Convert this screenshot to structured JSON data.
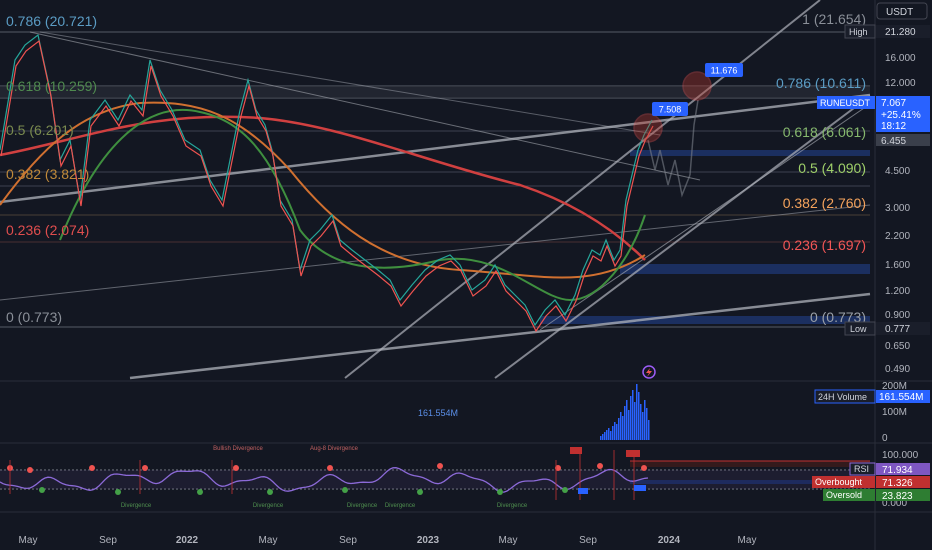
{
  "header": {
    "currency_button": "USDT"
  },
  "price_axis": {
    "ticks": [
      "16.000",
      "12.000",
      "6.455",
      "4.500",
      "3.000",
      "2.200",
      "1.600",
      "1.200",
      "0.900",
      "0.650",
      "0.490"
    ],
    "high": {
      "label": "High",
      "value": "21.280"
    },
    "low": {
      "label": "Low",
      "value": "0.777"
    },
    "current": {
      "symbol": "RUNEUSDT",
      "price": "7.067",
      "change": "+25.41%",
      "countdown": "18:12"
    }
  },
  "fib_left": [
    {
      "text": "0.786 (20.721)",
      "color": "#5b9cc4"
    },
    {
      "text": "0.618 (10.259)",
      "color": "#4f8a4f"
    },
    {
      "text": "0.5 (6.201)",
      "color": "#7a8a4f"
    },
    {
      "text": "0.382 (3.821)",
      "color": "#c08a3a"
    },
    {
      "text": "0.236 (2.074)",
      "color": "#e04e4e"
    },
    {
      "text": "0 (0.773)",
      "color": "#8a8f98"
    }
  ],
  "fib_right": [
    {
      "text": "1 (21.654)",
      "color": "#8a8f98"
    },
    {
      "text": "0.786 (10.611)",
      "color": "#5b9cc4"
    },
    {
      "text": "0.618 (6.061)",
      "color": "#86b86e"
    },
    {
      "text": "0.5 (4.090)",
      "color": "#9fd06a"
    },
    {
      "text": "0.382 (2.760)",
      "color": "#f5a35c"
    },
    {
      "text": "0.236 (1.697)",
      "color": "#f25656"
    },
    {
      "text": "0 (0.773)",
      "color": "#9aa0a8"
    }
  ],
  "callouts": [
    {
      "text": "7.508"
    },
    {
      "text": "11.676"
    }
  ],
  "volume": {
    "label": "24H Volume",
    "value": "161.554M",
    "inline_label": "161.554M",
    "ticks": [
      "200M",
      "100M",
      "0"
    ]
  },
  "rsi": {
    "ticks": [
      "100.000",
      "0.000"
    ],
    "rsi": {
      "label": "RSI",
      "value": "71.934"
    },
    "overbought": {
      "label": "Overbought",
      "value": "71.326"
    },
    "oversold": {
      "label": "Oversold",
      "value": "23.823"
    },
    "annotations": [
      "Bullish Divergence",
      "Aug-8 Divergence",
      "Divergence",
      "Divergence",
      "Divergence",
      "Divergence",
      "Divergence"
    ]
  },
  "time_axis": [
    "May",
    "Sep",
    "2022",
    "May",
    "Sep",
    "2023",
    "May",
    "Sep",
    "2024",
    "May"
  ],
  "chart_data": {
    "type": "line",
    "title": "RUNEUSDT",
    "series": [
      {
        "name": "RUNEUSDT",
        "x": [
          "2021-05",
          "2021-07",
          "2021-09",
          "2021-11",
          "2022-01",
          "2022-03",
          "2022-04",
          "2022-05",
          "2022-07",
          "2022-09",
          "2022-11",
          "2023-01",
          "2023-02",
          "2023-04",
          "2023-06",
          "2023-07",
          "2023-09",
          "2023-10",
          "2023-11",
          "2023-12",
          "2024-01"
        ],
        "values": [
          8,
          17,
          5,
          14,
          6,
          7,
          11,
          3,
          2.2,
          1.6,
          1.3,
          1.6,
          1.9,
          1.3,
          0.85,
          1.0,
          1.7,
          2.2,
          4.5,
          6.5,
          7.067
        ]
      }
    ],
    "ylim": [
      0.45,
      25
    ],
    "log_scale": true,
    "grid": true
  }
}
